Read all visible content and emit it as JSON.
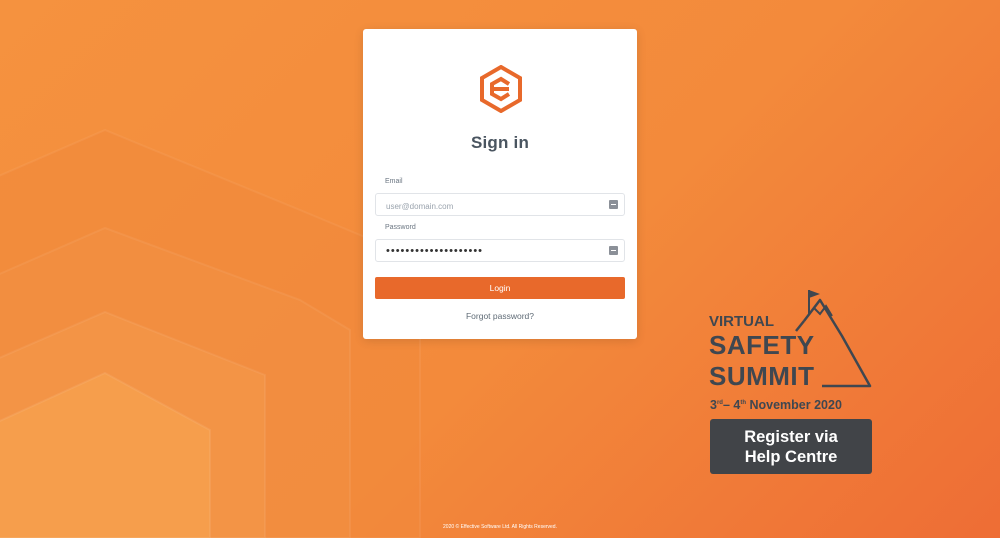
{
  "login": {
    "title": "Sign in",
    "email_label": "Email",
    "email_placeholder": "user@domain.com",
    "password_label": "Password",
    "password_value": "••••••••••••••••••••",
    "login_button": "Login",
    "forgot_password": "Forgot password?"
  },
  "promo": {
    "line1": "VIRTUAL",
    "line2": "SAFETY",
    "line3": "SUMMIT",
    "dates": {
      "start_day": "3",
      "start_suffix": "rd",
      "separator": "– ",
      "end_day": "4",
      "end_suffix": "th",
      "month_year": " November 2020"
    },
    "register_line1": "Register via",
    "register_line2": "Help Centre"
  },
  "footer": {
    "copyright": "2020 © Effective Software Ltd. All Rights Reserved."
  },
  "colors": {
    "background_start": "#f5923f",
    "background_end": "#ee6d35",
    "accent": "#e8692b",
    "promo_text": "#3f4750",
    "register_bg": "#414448"
  },
  "icons": {
    "logo": "effective-software-logo",
    "email_field_icon": "autofill-icon",
    "password_field_icon": "autofill-icon",
    "promo_graphic": "mountain-flag-icon"
  }
}
